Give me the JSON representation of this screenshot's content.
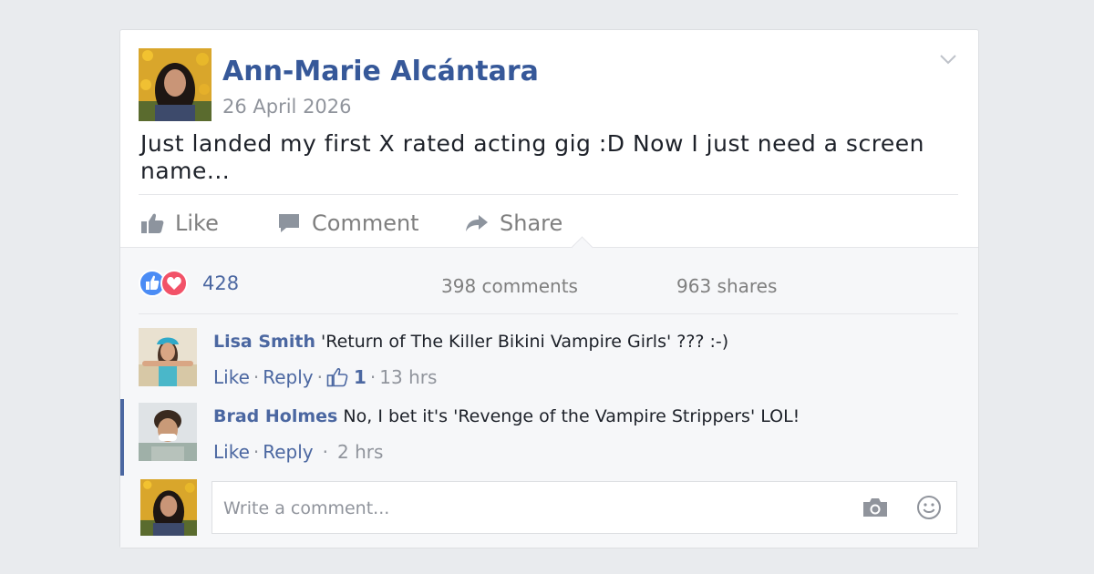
{
  "post": {
    "author": "Ann-Marie Alcántara",
    "date": "26 April 2026",
    "text": "Just landed my first X rated acting gig :D Now I just need a screen name...",
    "options_icon": "chevron-down-icon"
  },
  "actions": {
    "like": "Like",
    "comment": "Comment",
    "share": "Share"
  },
  "stats": {
    "reactions_count": "428",
    "reaction_icons": [
      "like-icon",
      "love-icon"
    ],
    "comments": "398 comments",
    "shares": "963 shares"
  },
  "comments": [
    {
      "name": "Lisa Smith",
      "text": "'Return of The Killer Bikini Vampire Girls' ??? :-)",
      "like": "Like",
      "reply": "Reply",
      "like_count": "1",
      "time": "13 hrs"
    },
    {
      "name": "Brad Holmes",
      "text": "No, I bet it's 'Revenge of the Vampire Strippers' LOL!",
      "like": "Like",
      "reply": "Reply",
      "time": "2 hrs"
    }
  ],
  "composer": {
    "placeholder": "Write a comment...",
    "icons": [
      "camera-icon",
      "smiley-icon"
    ]
  },
  "colors": {
    "brand_blue": "#4b67a1",
    "name_blue": "#365899",
    "love_red": "#f25268",
    "page_bg": "#e9ebee"
  }
}
